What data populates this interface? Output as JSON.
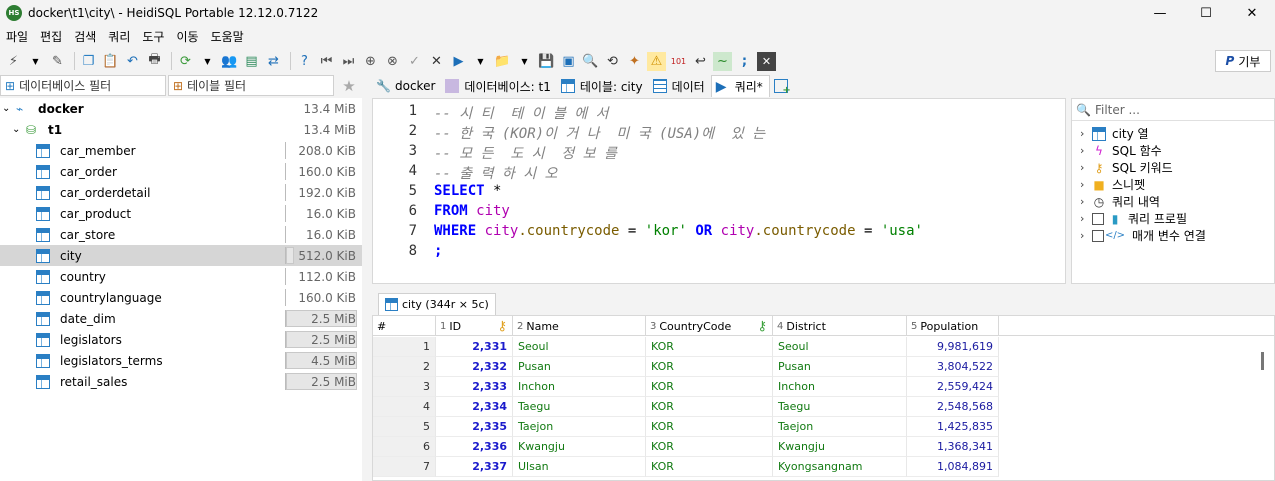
{
  "window": {
    "title": "docker\\t1\\city\\ - HeidiSQL Portable 12.12.0.7122",
    "app_badge": "HS"
  },
  "window_controls": {
    "minimize": "—",
    "maximize": "☐",
    "close": "✕"
  },
  "menu": [
    "파일",
    "편집",
    "검색",
    "쿼리",
    "도구",
    "이동",
    "도움말"
  ],
  "donate": {
    "label": "기부",
    "logo": "P"
  },
  "left_filters": {
    "db_filter": "데이터베이스 필터",
    "table_filter": "테이블 필터",
    "star": "★"
  },
  "tree": {
    "server": {
      "name": "docker",
      "size": "13.4 MiB"
    },
    "database": {
      "name": "t1",
      "size": "13.4 MiB"
    },
    "tables": [
      {
        "name": "car_member",
        "size": "208.0 KiB",
        "fill": 0.0
      },
      {
        "name": "car_order",
        "size": "160.0 KiB",
        "fill": 0.0
      },
      {
        "name": "car_orderdetail",
        "size": "192.0 KiB",
        "fill": 0.0
      },
      {
        "name": "car_product",
        "size": "16.0 KiB",
        "fill": 0.0
      },
      {
        "name": "car_store",
        "size": "16.0 KiB",
        "fill": 0.0
      },
      {
        "name": "city",
        "size": "512.0 KiB",
        "fill": 0.04
      },
      {
        "name": "country",
        "size": "112.0 KiB",
        "fill": 0.0
      },
      {
        "name": "countrylanguage",
        "size": "160.0 KiB",
        "fill": 0.0
      },
      {
        "name": "date_dim",
        "size": "2.5 MiB",
        "fill": 0.19
      },
      {
        "name": "legislators",
        "size": "2.5 MiB",
        "fill": 0.19
      },
      {
        "name": "legislators_terms",
        "size": "4.5 MiB",
        "fill": 0.34
      },
      {
        "name": "retail_sales",
        "size": "2.5 MiB",
        "fill": 0.19
      }
    ],
    "selected": "city"
  },
  "tabs": [
    {
      "label": "docker"
    },
    {
      "label": "데이터베이스: t1"
    },
    {
      "label": "테이블: city"
    },
    {
      "label": "데이터"
    },
    {
      "label": "쿼리*"
    }
  ],
  "editor": {
    "line_numbers": [
      "1",
      "2",
      "3",
      "4",
      "5",
      "6",
      "7",
      "8"
    ],
    "comments": [
      "-- 시 티  테 이 블 에 서",
      "-- 한 국 (KOR)이 거 나  미 국 (USA)에  있 는",
      "-- 모 든  도 시  정 보 를",
      "-- 출 력 하 시 오"
    ],
    "l5": {
      "kw": "SELECT",
      "rest": " *"
    },
    "l6": {
      "kw": "FROM",
      "tbl": " city"
    },
    "l7": {
      "kw1": "WHERE",
      "t1": " city",
      "f1": ".countrycode",
      "eq1": " = ",
      "s1": "'kor'",
      "or": " OR",
      "t2": " city",
      "f2": ".countrycode",
      "eq2": " = ",
      "s2": "'usa'"
    },
    "l8": ";"
  },
  "helper": {
    "filter_placeholder": "Filter ...",
    "items": [
      "city 열",
      "SQL 함수",
      "SQL 키워드",
      "스니펫",
      "쿼리 내역",
      "쿼리 프로필",
      "매개 변수 연결"
    ]
  },
  "result_tab": {
    "label": "city (344r × 5c)"
  },
  "grid": {
    "row_header": "#",
    "columns": [
      {
        "num": "1",
        "name": "ID"
      },
      {
        "num": "2",
        "name": "Name"
      },
      {
        "num": "3",
        "name": "CountryCode"
      },
      {
        "num": "4",
        "name": "District"
      },
      {
        "num": "5",
        "name": "Population"
      }
    ],
    "rows": [
      [
        "1",
        "2,331",
        "Seoul",
        "KOR",
        "Seoul",
        "9,981,619"
      ],
      [
        "2",
        "2,332",
        "Pusan",
        "KOR",
        "Pusan",
        "3,804,522"
      ],
      [
        "3",
        "2,333",
        "Inchon",
        "KOR",
        "Inchon",
        "2,559,424"
      ],
      [
        "4",
        "2,334",
        "Taegu",
        "KOR",
        "Taegu",
        "2,548,568"
      ],
      [
        "5",
        "2,335",
        "Taejon",
        "KOR",
        "Taejon",
        "1,425,835"
      ],
      [
        "6",
        "2,336",
        "Kwangju",
        "KOR",
        "Kwangju",
        "1,368,341"
      ],
      [
        "7",
        "2,337",
        "Ulsan",
        "KOR",
        "Kyongsangnam",
        "1,084,891"
      ]
    ]
  },
  "colors": {
    "accent": "#2a7fc4",
    "keyword": "#0000ff",
    "identifier": "#b000b0",
    "string": "#008000"
  }
}
